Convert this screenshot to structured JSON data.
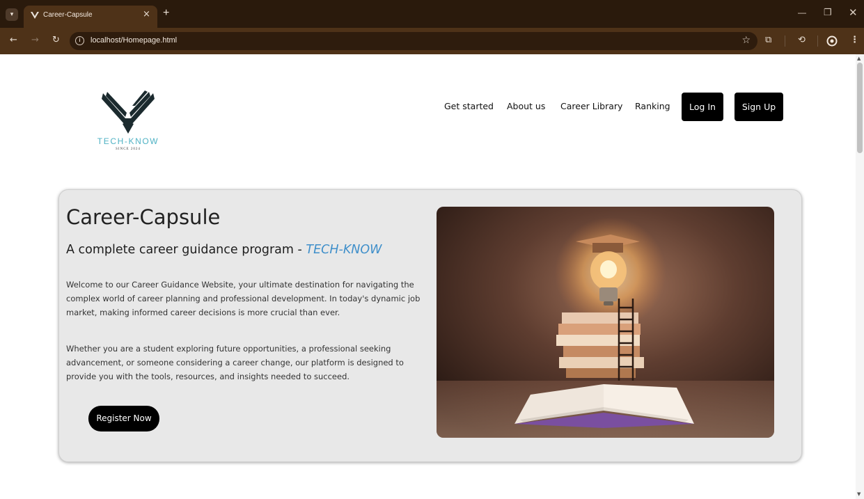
{
  "browser": {
    "tab_title": "Career-Capsule",
    "tab_close": "×",
    "new_tab": "+",
    "url": "localhost/Homepage.html",
    "icons": [
      "tab-search-icon",
      "favicon-icon",
      "back-icon",
      "forward-icon",
      "reload-icon",
      "site-info-icon",
      "star-icon",
      "extensions-icon",
      "history-icon",
      "profile-icon",
      "menu-icon",
      "minimize-icon",
      "restore-icon",
      "close-icon"
    ],
    "theme_colors": {
      "titlebar": "#2a1a0c",
      "toolbar": "#4e3218",
      "omnibox": "#2e1c0d"
    }
  },
  "header": {
    "logo": {
      "brand": "TECH-KNOW",
      "tagline": "SINCE 2024"
    },
    "nav": [
      "Get started",
      "About us",
      "Career Library",
      "Ranking"
    ],
    "login_label": "Log In",
    "signup_label": "Sign Up"
  },
  "hero": {
    "title": "Career-Capsule",
    "subtitle_prefix": "A complete career guidance program - ",
    "subtitle_accent": "TECH-KNOW",
    "paragraph_1": "Welcome to our Career Guidance Website, your ultimate destination for navigating the complex world of career planning and professional development. In today's dynamic job market, making informed career decisions is more crucial than ever.",
    "paragraph_2": "Whether you are a student exploring future opportunities, a professional seeking advancement, or someone considering a career change, our platform is designed to provide you with the tools, resources, and insights needed to succeed.",
    "cta_label": "Register Now",
    "image_icon": "lightbulb-books-illustration",
    "colors": {
      "accent": "#3f8fca",
      "card_bg": "#e8e8e8",
      "button_bg": "#000000"
    }
  }
}
